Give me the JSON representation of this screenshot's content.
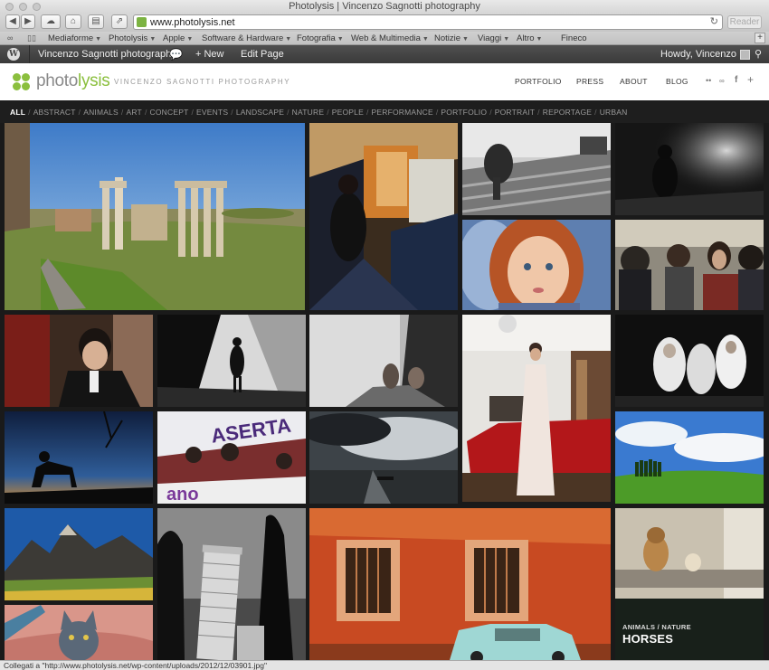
{
  "window": {
    "title": "Photolysis | Vincenzo Sagnotti photography"
  },
  "browser": {
    "url": "www.photolysis.net",
    "reader_label": "Reader",
    "bookmarks": [
      {
        "label": "Mediaforme",
        "menu": true
      },
      {
        "label": "Photolysis",
        "menu": true
      },
      {
        "label": "Apple",
        "menu": true
      },
      {
        "label": "Software & Hardware",
        "menu": true
      },
      {
        "label": "Fotografia",
        "menu": true
      },
      {
        "label": "Web & Multimedia",
        "menu": true
      },
      {
        "label": "Notizie",
        "menu": true
      },
      {
        "label": "Viaggi",
        "menu": true
      },
      {
        "label": "Altro",
        "menu": true
      },
      {
        "label": "Fineco",
        "menu": false
      }
    ]
  },
  "adminbar": {
    "site_name": "Vincenzo Sagnotti photography",
    "new_label": "New",
    "edit_label": "Edit Page",
    "howdy": "Howdy, Vincenzo"
  },
  "site": {
    "logo_prefix": "photo",
    "logo_suffix": "lysis",
    "tagline": "VINCENZO SAGNOTTI PHOTOGRAPHY",
    "nav": [
      "PORTFOLIO",
      "PRESS",
      "ABOUT",
      "BLOG"
    ],
    "social": [
      "••",
      "flickr-icon",
      "f",
      "+"
    ]
  },
  "filters": [
    "ALL",
    "ABSTRACT",
    "ANIMALS",
    "ART",
    "CONCEPT",
    "EVENTS",
    "LANDSCAPE",
    "NATURE",
    "PEOPLE",
    "PERFORMANCE",
    "PORTFOLIO",
    "PORTRAIT",
    "REPORTAGE",
    "URBAN"
  ],
  "active_filter": "ALL",
  "hover_tile": {
    "category": "ANIMALS / NATURE",
    "title": "HORSES"
  },
  "status": "Collegati a \"http://www.photolysis.net/wp-content/uploads/2012/12/03901.jpg\""
}
